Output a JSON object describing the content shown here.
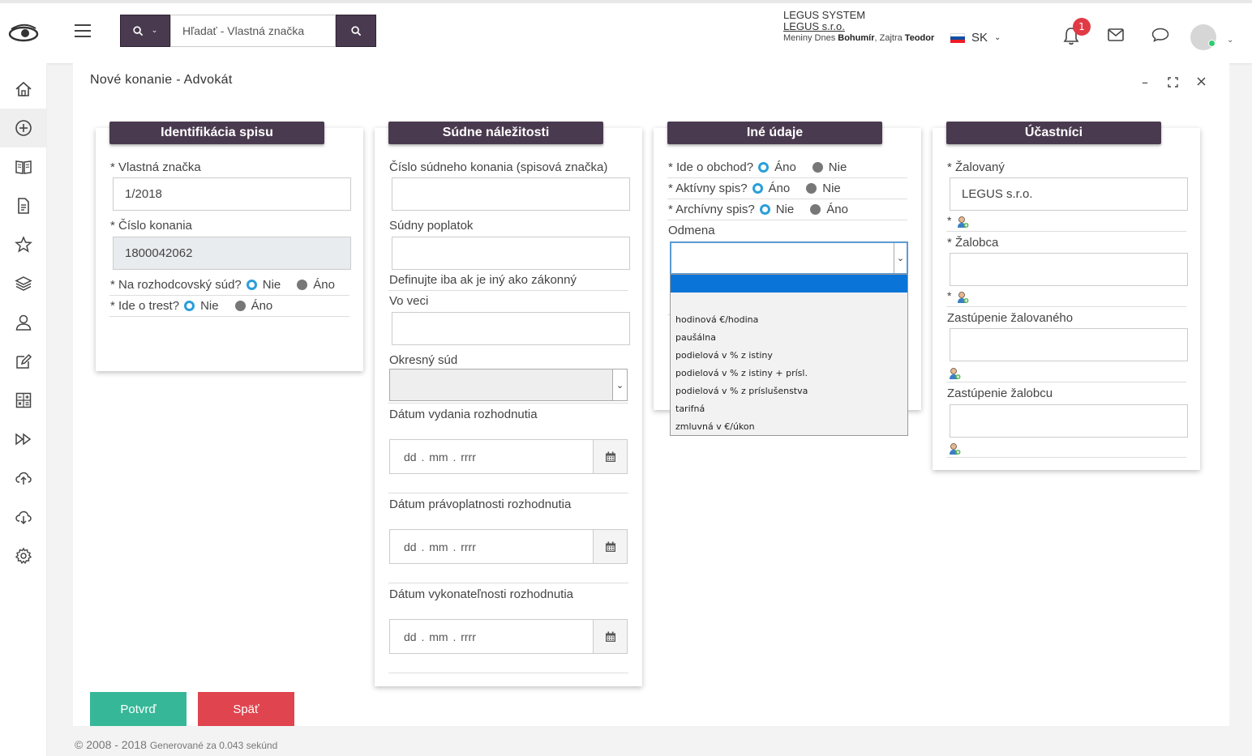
{
  "header": {
    "search_placeholder": "Hľadať - Vlastná značka",
    "company_line1": "LEGUS SYSTEM",
    "company_line2": "LEGUS s.r.o.",
    "nameday_prefix": "Meniny Dnes ",
    "nameday_today": "Bohumír",
    "nameday_mid": ", Zajtra ",
    "nameday_tomorrow": "Teodor",
    "language": "SK",
    "notification_count": "1",
    "colors": {
      "brand": "#4a3a4f",
      "badge": "#e03b45"
    }
  },
  "sidebar": {
    "items": [
      "home-icon",
      "add-circle-icon",
      "book-icon",
      "document-icon",
      "star-icon",
      "layers-icon",
      "user-icon",
      "edit-icon",
      "calculator-icon",
      "forward-icon",
      "cloud-upload-icon",
      "cloud-download-icon",
      "gear-icon"
    ]
  },
  "page": {
    "title": "Nové konanie - Advokát"
  },
  "identifikacia": {
    "heading": "Identifikácia spisu",
    "vlastna_label": "* Vlastná značka",
    "vlastna_value": "1/2018",
    "cislo_label": "* Číslo konania",
    "cislo_value": "1800042062",
    "rozhod_label": "* Na rozhodcovský súd?",
    "rozhod_opt1": "Nie",
    "rozhod_opt2": "Áno",
    "trest_label": "* Ide o trest?",
    "trest_opt1": "Nie",
    "trest_opt2": "Áno"
  },
  "sudne": {
    "heading": "Súdne náležitosti",
    "cislo_label": "Číslo súdneho konania (spisová značka)",
    "poplatok_label": "Súdny poplatok",
    "poplatok_hint": "Definujte iba ak je iný ako zákonný",
    "vo_veci_label": "Vo veci",
    "okresny_label": "Okresný súd",
    "datum_vydania_label": "Dátum vydania rozhodnutia",
    "datum_pravop_label": "Dátum právoplatnosti rozhodnutia",
    "datum_vykon_label": "Dátum vykonateľnosti rozhodnutia",
    "date_placeholder": "dd . mm . rrrr"
  },
  "ine": {
    "heading": "Iné údaje",
    "obchod_label": "* Ide o obchod?",
    "obchod_opt1": "Áno",
    "obchod_opt2": "Nie",
    "aktivny_label": "* Aktívny spis?",
    "aktivny_opt1": "Áno",
    "aktivny_opt2": "Nie",
    "archivny_label": "* Archívny spis?",
    "archivny_opt1": "Nie",
    "archivny_opt2": "Áno",
    "odmena_label": "Odmena",
    "odmena_options": [
      "",
      "hodinová €/hodina",
      "paušálna",
      "podielová v % z istiny",
      "podielová v % z istiny + prísl.",
      "podielová v % z príslušenstva",
      "tarifná",
      "zmluvná v €/úkon"
    ]
  },
  "ucastnici": {
    "heading": "Účastníci",
    "zalovany_label": "* Žalovaný",
    "zalovany_value": "LEGUS s.r.o.",
    "zalobca_label": "* Žalobca",
    "zast_zalovaneho_label": "Zastúpenie žalovaného",
    "zast_zalobcu_label": "Zastúpenie žalobcu",
    "required_mark": "*"
  },
  "actions": {
    "confirm": "Potvrď",
    "back": "Späť",
    "confirm_color": "#36b898",
    "back_color": "#e0444f"
  },
  "footer": {
    "copyright": "© 2008 - 2018",
    "generated": "Generované za 0.043 sekúnd"
  }
}
